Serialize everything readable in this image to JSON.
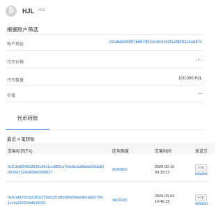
{
  "header": {
    "logo_icon": "bitcoin-icon",
    "logo_glyph": "₿",
    "token_name": "HJL",
    "token_symbol": "HJL"
  },
  "filter": {
    "title": "根据账户筛选"
  },
  "info": {
    "address_label": "账户地址",
    "address_value": "0xfa6dd2b9976d67852cc4b3180f1ef8892c4ad87c",
    "price_label": "代币价格",
    "price_value": "- / -",
    "quantity_label": "代币数量",
    "quantity_value": "100,000 HJL",
    "value_label": "价值",
    "value_value": "—"
  },
  "tabs": {
    "transfers_label": "代币转账"
  },
  "transfers": {
    "summary": "最近 4 笔转账",
    "columns": {
      "hash": "交易标识(TX)",
      "block": "区块高度",
      "time": "交易时间",
      "from": "发送方"
    },
    "rows": [
      {
        "hash": "0x21b6894208533c90c1cc8831a75dc8c3a8bbdd29da810920d7326042842609827",
        "block": "9640810",
        "time_date": "2020-03-10",
        "time_clock": "09:39:13",
        "badge": "FTE",
        "from": "0xfa6dd"
      },
      {
        "hash": "0x4caf82053d33f1b376d1c2f18b08f9436e64bcbb82784 1cc4e65252dd643660",
        "block": "9603180",
        "time_date": "2020-03-04",
        "time_clock": "14:46:15",
        "badge": "FTE",
        "from": "0xfa6dd"
      }
    ]
  }
}
